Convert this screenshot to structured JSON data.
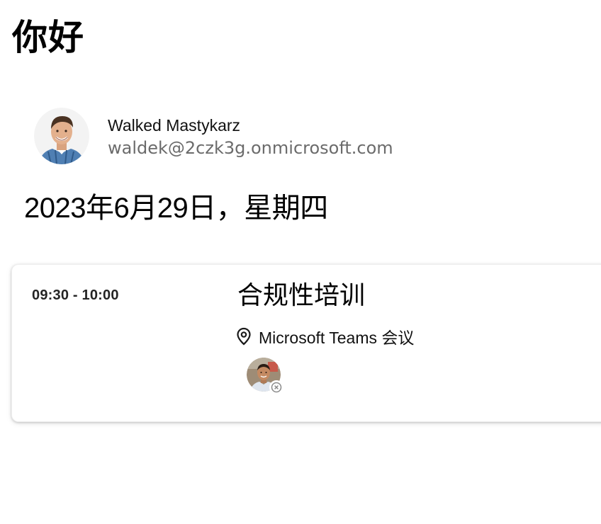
{
  "header": {
    "greeting": "你好"
  },
  "user": {
    "name": "Walked Mastykarz",
    "email": "waldek@2czk3g.onmicrosoft.com",
    "avatar_icon": "user-avatar-photo"
  },
  "agenda": {
    "date": "2023年6月29日，星期四",
    "events": [
      {
        "time": "09:30 - 10:00",
        "title": "合规性培训",
        "location": "Microsoft Teams 会议",
        "location_icon": "location-pin-icon",
        "attendees": [
          {
            "avatar_icon": "attendee-avatar-photo",
            "presence_icon": "presence-offline-icon"
          }
        ]
      }
    ]
  },
  "colors": {
    "background": "#ffffff",
    "text": "#000000",
    "email_text": "#6b6b6b",
    "card_shadow": "#d0d0d0"
  }
}
